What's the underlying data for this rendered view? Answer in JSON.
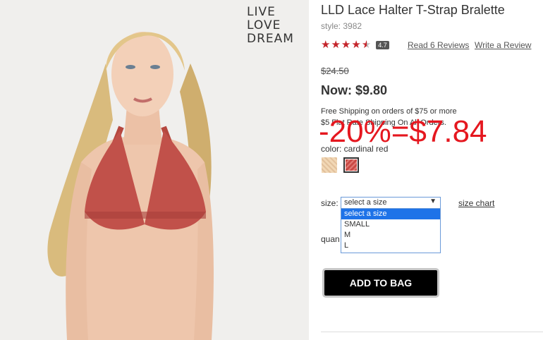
{
  "brand": {
    "line1": "LIVE",
    "line2": "LOVE",
    "line3": "DREAM"
  },
  "product": {
    "title": "LLD Lace Halter T-Strap Bralette",
    "style": "style: 3982",
    "rating": 4.7,
    "rating_badge": "4.7",
    "read_reviews": "Read 6 Reviews",
    "write_review": "Write a Review",
    "old_price": "$24.50",
    "now_price": "Now: $9.80",
    "shipping_line1": "Free Shipping on orders of $75 or more",
    "shipping_line2": "$5 Flat Rate Shipping On All Orders.",
    "discount_note": "-20%=$7.84",
    "color_label": "color: cardinal red",
    "size_label": "size:",
    "size_select": {
      "value": "select a size",
      "options": [
        "select a size",
        "SMALL",
        "M",
        "L"
      ]
    },
    "size_chart": "size chart",
    "quantity_label": "quan",
    "add_to_bag": "ADD TO BAG"
  },
  "colors": {
    "accent_red": "#c4242a",
    "discount_red": "#e5171f",
    "dropdown_selected": "#1e73e8",
    "button_bg": "#000000"
  }
}
